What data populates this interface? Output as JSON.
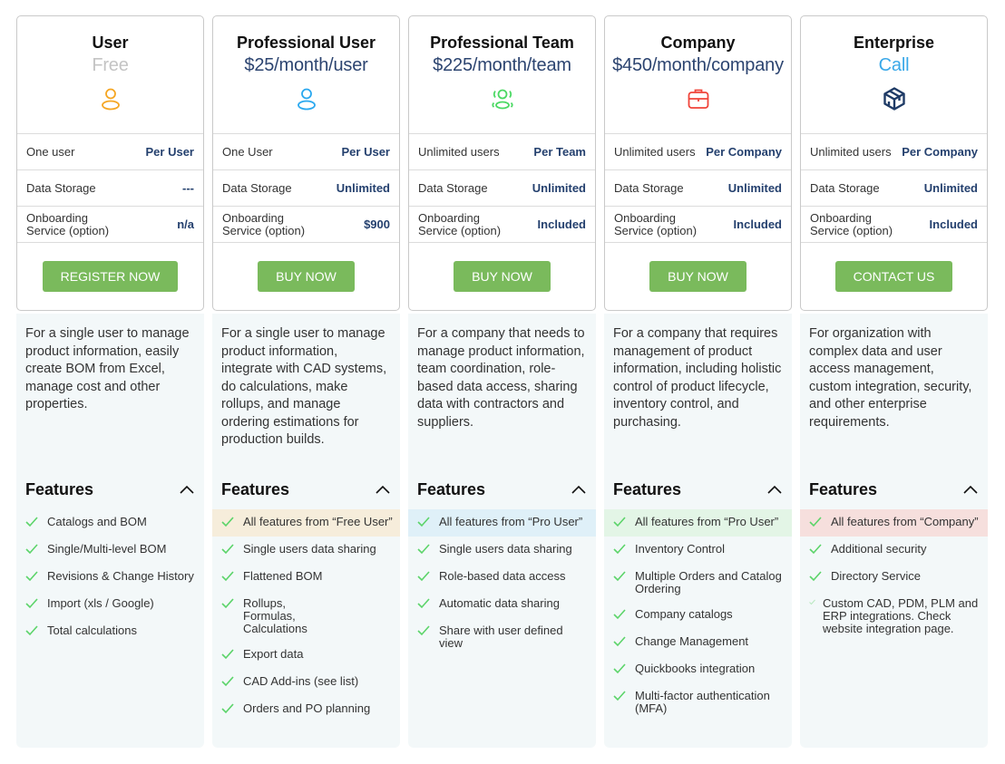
{
  "colors": {
    "accent_button": "#7aba5c",
    "value_text": "#24406e",
    "check": "#5cd46a",
    "panel_bg": "#f3f8f9"
  },
  "plans": [
    {
      "name": "User",
      "price": "Free",
      "icon": "user-icon",
      "icon_color": "#f5a623",
      "specs": [
        {
          "label": "One user",
          "value": "Per User"
        },
        {
          "label": "Data Storage",
          "value": "---"
        },
        {
          "label": "Onboarding Service (option)",
          "value": "n/a"
        }
      ],
      "cta": "REGISTER NOW",
      "description": "For a single user to manage product information, easily create BOM from Excel, manage cost and other properties.",
      "features_title": "Features",
      "features": [
        "Catalogs and BOM",
        "Single/Multi-level BOM",
        "Revisions & Change History",
        "Import (xls / Google)",
        "Total calculations"
      ]
    },
    {
      "name": "Professional User",
      "price": "$25/month/user",
      "icon": "user-icon",
      "icon_color": "#2aa8ef",
      "specs": [
        {
          "label": "One User",
          "value": "Per User"
        },
        {
          "label": "Data Storage",
          "value": "Unlimited"
        },
        {
          "label": "Onboarding Service (option)",
          "value": "$900"
        }
      ],
      "cta": "BUY NOW",
      "description": "For a single user to manage product information, integrate with CAD systems, do calculations, make rollups, and manage ordering estimations for production builds.",
      "features_title": "Features",
      "features": [
        "All features from “Free User”",
        "Single users data sharing",
        "Flattened BOM",
        "Rollups, Formulas, Calculations",
        "Export data",
        "CAD Add-ins (see list)",
        "Orders and PO planning"
      ]
    },
    {
      "name": "Professional Team",
      "price": "$225/month/team",
      "icon": "team-icon",
      "icon_color": "#4cd964",
      "specs": [
        {
          "label": "Unlimited users",
          "value": "Per Team"
        },
        {
          "label": "Data Storage",
          "value": "Unlimited"
        },
        {
          "label": "Onboarding Service (option)",
          "value": "Included"
        }
      ],
      "cta": "BUY NOW",
      "description": "For a company that needs to manage product information, team coordination, role-based data access, sharing data with contractors and suppliers.",
      "features_title": "Features",
      "features": [
        "All features from “Pro User”",
        "Single users data sharing",
        "Role-based data access",
        "Automatic data sharing",
        "Share with user defined view"
      ]
    },
    {
      "name": "Company",
      "price": "$450/month/company",
      "icon": "briefcase-icon",
      "icon_color": "#f0443a",
      "specs": [
        {
          "label": "Unlimited users",
          "value": "Per Company"
        },
        {
          "label": "Data Storage",
          "value": "Unlimited"
        },
        {
          "label": "Onboarding Service (option)",
          "value": "Included"
        }
      ],
      "cta": "BUY NOW",
      "description": "For a company that requires management of product information, including holistic control of product lifecycle, inventory control, and purchasing.",
      "features_title": "Features",
      "features": [
        "All features from “Pro User”",
        "Inventory Control",
        "Multiple Orders and Catalog Ordering",
        "Company catalogs",
        "Change Management",
        "Quickbooks integration",
        "Multi-factor authentication (MFA)"
      ]
    },
    {
      "name": "Enterprise",
      "price": "Call",
      "icon": "cube-icon",
      "icon_color": "#1f3b66",
      "specs": [
        {
          "label": "Unlimited users",
          "value": "Per Company"
        },
        {
          "label": "Data Storage",
          "value": "Unlimited"
        },
        {
          "label": "Onboarding Service (option)",
          "value": "Included"
        }
      ],
      "cta": "CONTACT US",
      "description": "For organization with complex data and user access management, custom integration, security, and other enterprise requirements.",
      "features_title": "Features",
      "features": [
        "All features from “Company”",
        "Additional security",
        "Directory Service",
        "Custom CAD, PDM, PLM and ERP integrations. Check website integration page."
      ]
    }
  ]
}
